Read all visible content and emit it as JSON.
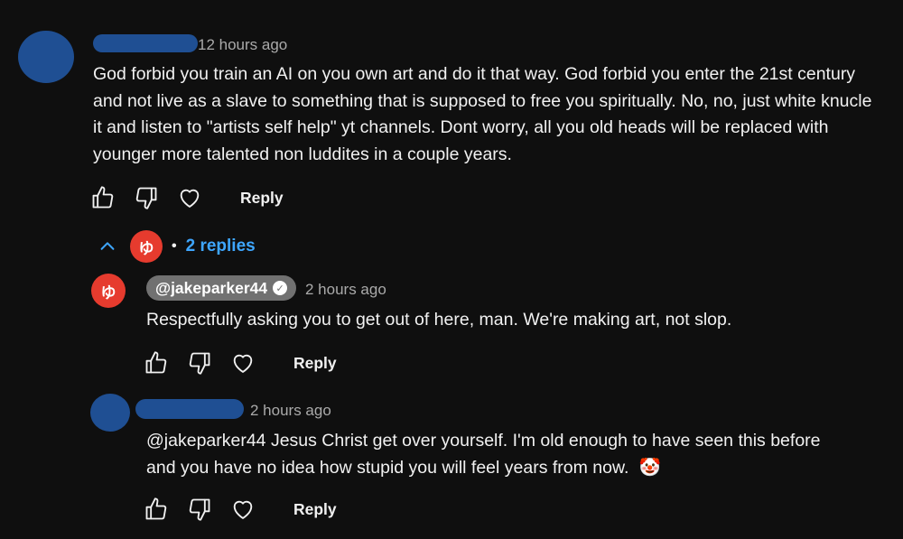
{
  "top_comment": {
    "timestamp": "12 hours ago",
    "text": "God forbid you train an AI on you own art and do it that way. God forbid you enter the 21st century and not live as a slave to something that is supposed to free you spiritually. No, no, just white knucle it and listen to \"artists self help\" yt channels. Dont worry, all you old heads will be replaced with younger more talented non luddites in a couple years.",
    "reply_label": "Reply"
  },
  "replies_toggle": {
    "label": "2 replies",
    "separator": "•",
    "icon": "chevron-up-icon"
  },
  "reply_1": {
    "author": "@jakeparker44",
    "verified": true,
    "avatar_glyph": "ゆ",
    "timestamp": "2 hours ago",
    "text": "Respectfully asking you to get out of here, man. We're making art, not slop.",
    "reply_label": "Reply"
  },
  "reply_2": {
    "timestamp": "2 hours ago",
    "text_line1": "@jakeparker44  Jesus Christ get over yourself. I'm old enough to have seen this before",
    "text_line2": "and you have no idea how stupid you will feel years from now.",
    "emoji": "🤡",
    "reply_label": "Reply"
  },
  "colors": {
    "background": "#0f0f0f",
    "link_blue": "#3ea6ff",
    "creator_red": "#e63b2e",
    "redaction_blue": "#1f4f93",
    "chip_gray": "#717171"
  }
}
